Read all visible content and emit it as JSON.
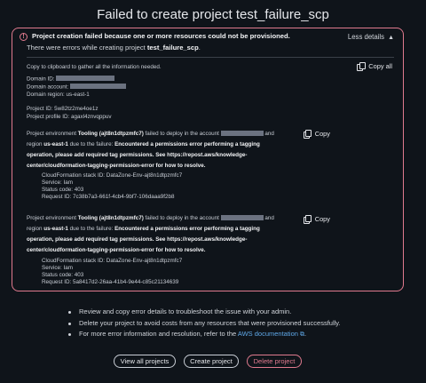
{
  "title": "Failed to create project test_failure_scp",
  "alert": {
    "heading": "Project creation failed because one or more resources could not be provisioned.",
    "sub_prefix": "There were errors while creating project ",
    "sub_project": "test_failure_scp",
    "sub_suffix": ".",
    "less_details": "Less details",
    "copy_hint": "Copy to clipboard to gather all the information needed.",
    "copy_all": "Copy all",
    "domain_id_label": "Domain ID:",
    "domain_account_label": "Domain account:",
    "domain_region": "Domain region: us-east-1",
    "project_id": "Project ID: 5w82tz2me4oe1z",
    "project_profile_id": "Project profile ID: agaxl4znvqppuv"
  },
  "errors": [
    {
      "line1_prefix": "Project environment ",
      "line1_env": "Tooling (ajt8n1dtpzmfc7)",
      "line1_suffix": " failed to deploy in the account",
      "line1_end": "and",
      "line2_prefix": "region ",
      "line2_region": "us-east-1",
      "line2_mid": " due to the failure: ",
      "line2_bold": "Encountered a permissions error performing a tagging",
      "line3": "operation, please add required tag permissions. See https://repost.aws/knowledge-",
      "line4": "center/cloudformation-tagging-permission-error for how to resolve.",
      "stack": "CloudFormation stack ID: DataZone-Env-ajt8n1dtpzmfc7",
      "service": "Service: Iam",
      "status": "Status code: 403",
      "request": "Request ID: 7c38b7a3-661f-4cb4-9bf7-106daaa9f2b8",
      "copy": "Copy"
    },
    {
      "line1_prefix": "Project environment ",
      "line1_env": "Tooling (ajt8n1dtpzmfc7)",
      "line1_suffix": " failed to deploy in the account",
      "line1_end": "and",
      "line2_prefix": "region ",
      "line2_region": "us-east-1",
      "line2_mid": " due to the failure: ",
      "line2_bold": "Encountered a permissions error performing a tagging",
      "line3": "operation, please add required tag permissions. See https://repost.aws/knowledge-",
      "line4": "center/cloudformation-tagging-permission-error for how to resolve.",
      "stack": "CloudFormation stack ID: DataZone-Env-ajt8n1dtpzmfc7",
      "service": "Service: Iam",
      "status": "Status code: 403",
      "request": "Request ID: 5a8417d2-26aa-41b4-9e44-c85c21134639",
      "copy": "Copy"
    }
  ],
  "bullets": {
    "b1": "Review and copy error details to troubleshoot the issue with your admin.",
    "b2": "Delete your project to avoid costs from any resources that were provisioned successfully.",
    "b3_prefix": "For more error information and resolution, refer to the ",
    "b3_link": "AWS documentation",
    "b3_suffix": "."
  },
  "buttons": {
    "view_all": "View all projects",
    "create": "Create project",
    "delete": "Delete project"
  },
  "colors": {
    "background": "#0f141a",
    "error_border": "#e07a8e",
    "link": "#5fa8e8"
  }
}
